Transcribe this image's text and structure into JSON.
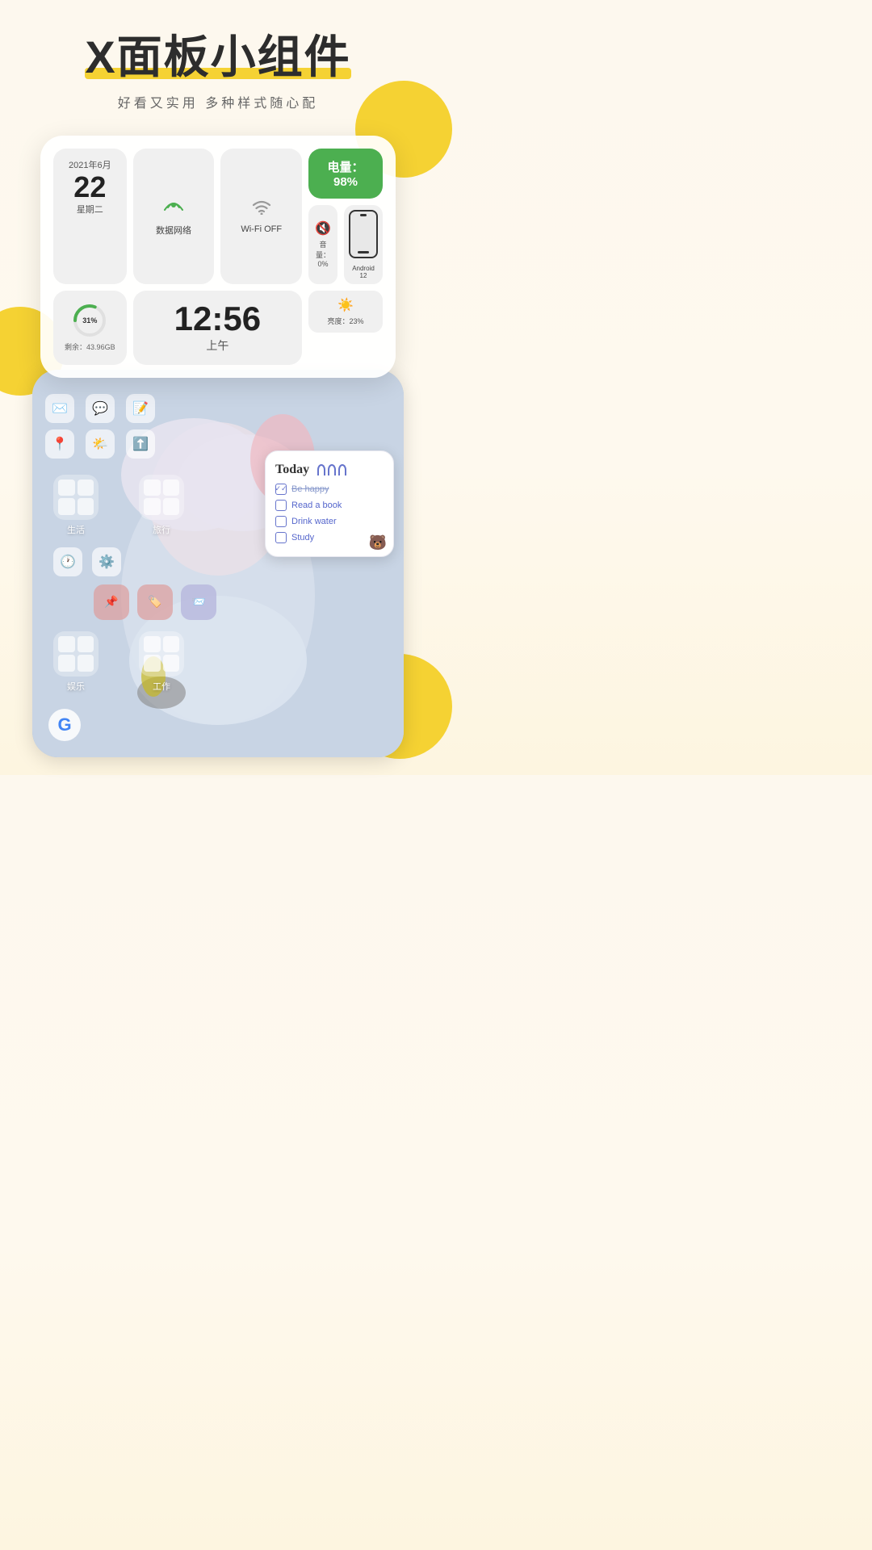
{
  "header": {
    "title": "X面板小组件",
    "subtitle": "好看又实用  多种样式随心配"
  },
  "widget": {
    "date": {
      "year_month": "2021年6月",
      "day": "22",
      "weekday": "星期二"
    },
    "data_network": {
      "label": "数据网络"
    },
    "wifi": {
      "label": "Wi-Fi OFF"
    },
    "battery": {
      "text": "电量：98%"
    },
    "volume": {
      "label": "音量：0%"
    },
    "brightness": {
      "label": "亮度：23%"
    },
    "android": {
      "label": "Android 12"
    },
    "storage": {
      "percent": "31%",
      "remaining": "剩余：43.96GB",
      "ring_value": 31
    },
    "clock": {
      "time": "12:56",
      "ampm": "上午"
    }
  },
  "todo_widget": {
    "title": "Today",
    "items": [
      {
        "text": "Be happy",
        "checked": true,
        "strikethrough": true
      },
      {
        "text": "Read a book",
        "checked": false,
        "strikethrough": false
      },
      {
        "text": "Drink water",
        "checked": false,
        "strikethrough": false
      },
      {
        "text": "Study",
        "checked": false,
        "strikethrough": false
      }
    ]
  },
  "phone_screen": {
    "folders": [
      {
        "label": "生活"
      },
      {
        "label": "旅行"
      },
      {
        "label": "娱乐"
      },
      {
        "label": "工作"
      }
    ],
    "google_label": "G"
  }
}
